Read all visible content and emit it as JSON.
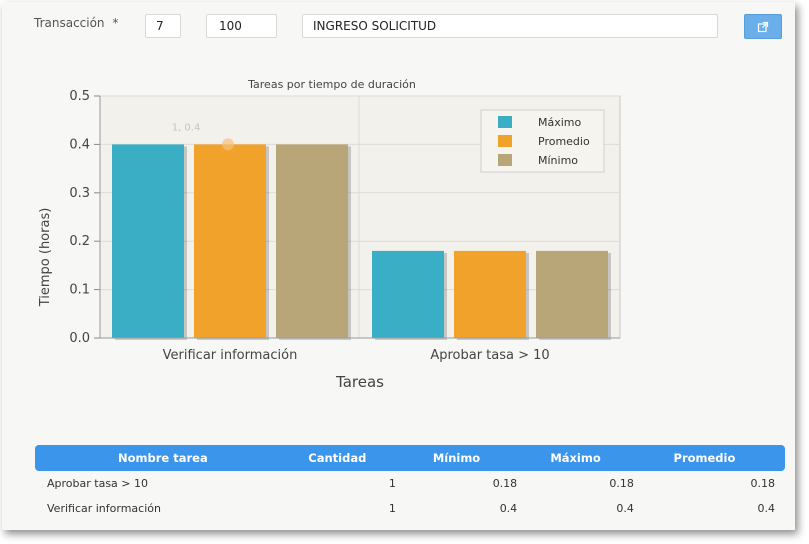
{
  "form": {
    "transaction_label": "Transacción",
    "required_mark": "*",
    "field_a": "7",
    "field_b": "100",
    "field_c": "INGRESO SOLICITUD"
  },
  "colors": {
    "maximo": "#3aaec4",
    "promedio": "#f0a22a",
    "minimo": "#b9a678",
    "header_bg": "#3b95ea",
    "button_bg": "#6aaeea"
  },
  "icons": {
    "external": "external-link-icon"
  },
  "chart_data": {
    "type": "bar",
    "title": "Tareas por tiempo de duración",
    "xlabel": "Tareas",
    "ylabel": "Tiempo (horas)",
    "ylim": [
      0,
      0.5
    ],
    "yticks": [
      "0.0",
      "0.1",
      "0.2",
      "0.3",
      "0.4",
      "0.5"
    ],
    "categories": [
      "Verificar información",
      "Aprobar tasa > 10"
    ],
    "series": [
      {
        "name": "Máximo",
        "values": [
          0.4,
          0.18
        ]
      },
      {
        "name": "Promedio",
        "values": [
          0.4,
          0.18
        ]
      },
      {
        "name": "Mínimo",
        "values": [
          0.4,
          0.18
        ]
      }
    ],
    "annotation": "1, 0.4",
    "legend": "top-right",
    "grid": true
  },
  "table": {
    "headers": [
      "Nombre tarea",
      "Cantidad",
      "Mínimo",
      "Máximo",
      "Promedio"
    ],
    "rows": [
      [
        "Aprobar tasa > 10",
        "1",
        "0.18",
        "0.18",
        "0.18"
      ],
      [
        "Verificar información",
        "1",
        "0.4",
        "0.4",
        "0.4"
      ]
    ]
  }
}
